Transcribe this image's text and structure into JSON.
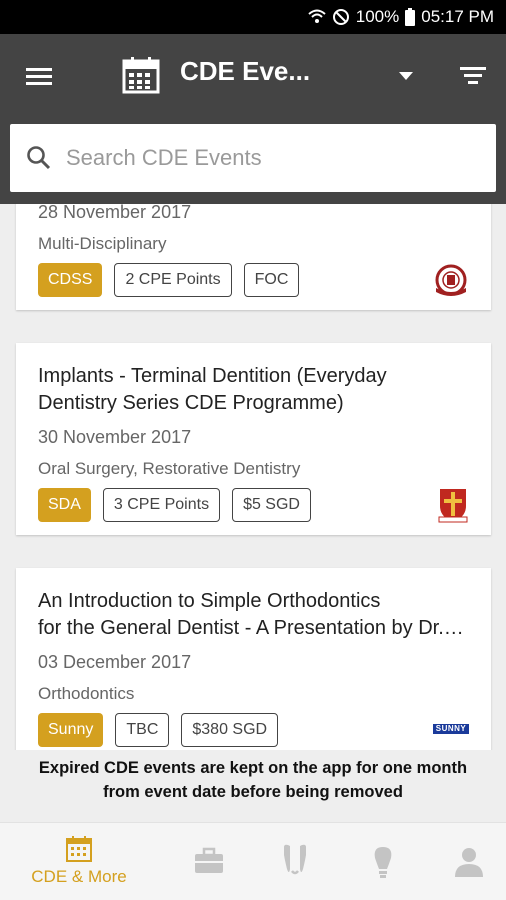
{
  "status": {
    "battery": "100%",
    "time": "05:17 PM"
  },
  "app_bar": {
    "title": "CDE Eve..."
  },
  "search": {
    "placeholder": "Search CDE Events"
  },
  "events": [
    {
      "date": "28 November 2017",
      "category": "Multi-Disciplinary",
      "organizer": "CDSS",
      "points": "2 CPE Points",
      "fee": "FOC"
    },
    {
      "title_line1": "Implants - Terminal Dentition (Everyday",
      "title_line2": "Dentistry Series CDE Programme)",
      "date": "30 November 2017",
      "category": "Oral Surgery, Restorative Dentistry",
      "organizer": "SDA",
      "points": "3 CPE Points",
      "fee": "$5 SGD"
    },
    {
      "title_line1": "An Introduction to Simple Orthodontics",
      "title_line2": "for the General Dentist - A Presentation by Dr. Lim",
      "date": "03 December 2017",
      "category": "Orthodontics",
      "organizer": "Sunny",
      "points": "TBC",
      "fee": "$380 SGD",
      "logo_text": "SUNNY"
    }
  ],
  "notice": {
    "line1": "Expired CDE events are kept on the app for one month",
    "line2": "from event date before being removed"
  },
  "bottom_nav": {
    "active_label": "CDE & More"
  },
  "colors": {
    "accent": "#d4a01f",
    "app_bar": "#444444"
  }
}
